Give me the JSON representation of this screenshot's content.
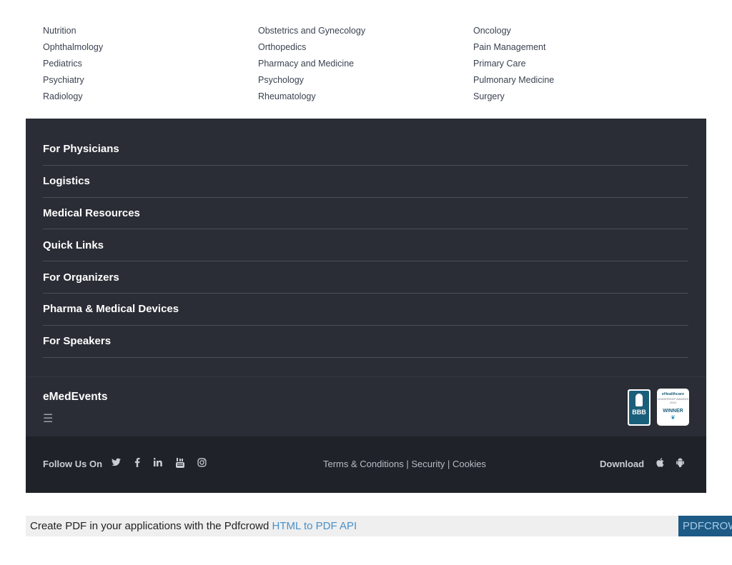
{
  "specialties": [
    [
      "Nutrition",
      "Obstetrics and Gynecology",
      "Oncology"
    ],
    [
      "Ophthalmology",
      "Orthopedics",
      "Pain Management"
    ],
    [
      "Pediatrics",
      "Pharmacy and Medicine",
      "Primary Care"
    ],
    [
      "Psychiatry",
      "Psychology",
      "Pulmonary Medicine"
    ],
    [
      "Radiology",
      "Rheumatology",
      "Surgery"
    ]
  ],
  "footer_menu": [
    "For Physicians",
    "Logistics",
    "Medical Resources",
    "Quick Links",
    "For Organizers",
    "Pharma & Medical Devices",
    "For Speakers"
  ],
  "brand": {
    "name": "eMedEvents",
    "menu_glyph": "☰",
    "bbb_text": "BBB",
    "award_line1": "eHealthcare",
    "award_line2": "LEADERSHIP AWARDS 2020",
    "award_line3": "WINNER"
  },
  "bottom": {
    "follow_label": "Follow Us On",
    "social_icons": [
      "twitter-icon",
      "facebook-icon",
      "linkedin-icon",
      "youtube-icon",
      "instagram-icon"
    ],
    "terms": "Terms & Conditions",
    "security": "Security",
    "cookies": "Cookies",
    "separator": "|",
    "download_label": "Download",
    "download_icons": [
      "apple-icon",
      "android-icon"
    ]
  },
  "pdf_banner": {
    "text": "Create PDF in your applications with the Pdfcrowd ",
    "link": "HTML to PDF API",
    "brand": "PDFCROWD"
  },
  "colors": {
    "footer_bg": "#2a2d35",
    "bottom_bg": "#1f2228",
    "pdf_link": "#4a90c8",
    "pdf_brand_bg": "#1d5a86"
  }
}
